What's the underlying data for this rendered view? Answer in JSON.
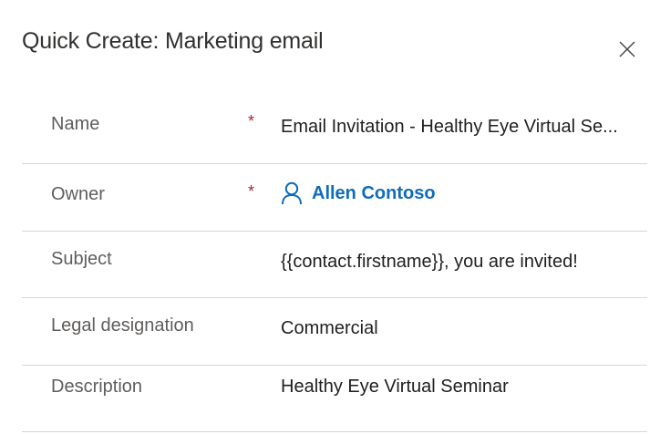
{
  "panel": {
    "title": "Quick Create: Marketing email",
    "close_icon": "close-icon"
  },
  "form": {
    "required_marker": "*",
    "fields": [
      {
        "label": "Name",
        "value": "Email Invitation - Healthy Eye Virtual Se...",
        "required": true
      },
      {
        "label": "Owner",
        "value": "Allen Contoso",
        "required": true,
        "icon": "person-icon",
        "link_color": "#0f6cbd"
      },
      {
        "label": "Subject",
        "value": "{{contact.firstname}}, you are invited!",
        "required": false
      },
      {
        "label": "Legal designation",
        "value": "Commercial",
        "required": false
      },
      {
        "label": "Description",
        "value": "Healthy Eye Virtual Seminar",
        "required": false
      }
    ]
  },
  "colors": {
    "required": "#a4262c",
    "link": "#0f6cbd",
    "label": "#605e5c",
    "divider": "#d6d6d6"
  }
}
